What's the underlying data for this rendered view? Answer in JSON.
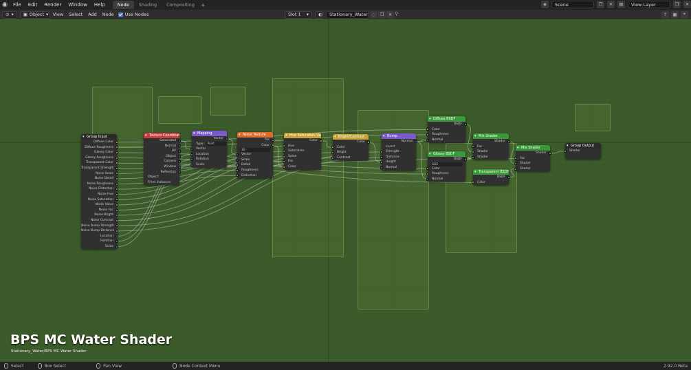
{
  "topbar": {
    "menus": [
      "File",
      "Edit",
      "Render",
      "Window",
      "Help"
    ],
    "workspaces": [
      "Node",
      "Shading",
      "Compositing"
    ],
    "active_workspace": "Node",
    "scene": "Scene",
    "view_layer": "View Layer"
  },
  "header": {
    "object_mode": "Object",
    "menus": [
      "View",
      "Select",
      "Add",
      "Node"
    ],
    "use_nodes": "Use Nodes",
    "slot": "Slot 1",
    "material": "Stationary_Water"
  },
  "overlay": {
    "title": "BPS MC Water Shader",
    "path": "Stationary_Water/BPS MC Water Shader"
  },
  "nodes": {
    "group_input": {
      "title": "Group Input",
      "outputs": [
        "Diffuse Color",
        "Diffuse Roughness",
        "Glossy Color",
        "Glossy Roughness",
        "Transparent Color",
        "Transparent Strength",
        "Noise Scale",
        "Noise Detail",
        "Noise Roughness",
        "Noise Distortion",
        "Noise Hue",
        "Noise Saturation",
        "Noise Value",
        "Noise Fac",
        "Noise Bright",
        "Noise Contrast",
        "Noise Bump Strength",
        "Noise Bump Distance",
        "Location",
        "Rotation",
        "Scale"
      ]
    },
    "texcoord": {
      "title": "Texture Coordinate",
      "outputs": [
        "Generated",
        "Normal",
        "UV",
        "Object",
        "Camera",
        "Window",
        "Reflection"
      ],
      "object_label": "Object:",
      "from_instancer": "From Instancer"
    },
    "mapping": {
      "title": "Mapping",
      "output": "Vector",
      "type_label": "Type:",
      "type_value": "Point",
      "inputs": [
        "Vector",
        "Location",
        "Rotation",
        "Scale"
      ]
    },
    "noise": {
      "title": "Noise Texture",
      "outputs": [
        "Fac",
        "Color"
      ],
      "dimension": "3D",
      "inputs": [
        "Vector",
        "Scale",
        "Detail",
        "Roughness",
        "Distortion"
      ]
    },
    "hsv": {
      "title": "Hue Saturation Value",
      "output": "Color",
      "inputs": [
        "Hue",
        "Saturation",
        "Value",
        "Fac",
        "Color"
      ]
    },
    "bright": {
      "title": "Bright/Contrast",
      "output": "Color",
      "inputs": [
        "Color",
        "Bright",
        "Contrast"
      ]
    },
    "bump": {
      "title": "Bump",
      "output": "Normal",
      "invert": "Invert",
      "inputs": [
        "Strength",
        "Distance",
        "Height",
        "Normal"
      ]
    },
    "diffuse": {
      "title": "Diffuse BSDF",
      "output": "BSDF",
      "inputs": [
        "Color",
        "Roughness",
        "Normal"
      ]
    },
    "glossy": {
      "title": "Glossy BSDF",
      "output": "BSDF",
      "distribution": "GGX",
      "inputs": [
        "Color",
        "Roughness",
        "Normal"
      ]
    },
    "transparent": {
      "title": "Transparent BSDF",
      "output": "BSDF",
      "inputs": [
        "Color"
      ]
    },
    "mix1": {
      "title": "Mix Shader",
      "output": "Shader",
      "inputs": [
        "Fac",
        "Shader",
        "Shader"
      ]
    },
    "mix2": {
      "title": "Mix Shader",
      "output": "Shader",
      "inputs": [
        "Fac",
        "Shader",
        "Shader"
      ]
    },
    "group_output": {
      "title": "Group Output",
      "inputs": [
        "Shader"
      ]
    }
  },
  "statusbar": {
    "select": "Select",
    "box_select": "Box Select",
    "pan_view": "Pan View",
    "context_menu": "Node Context Menu",
    "version": "2.92.0 Beta"
  },
  "colors": {
    "canvas": "#3b5a29",
    "input_header": "#2a2a2a",
    "texture_header": "#e06a2a",
    "vector_header": "#7c5ac7",
    "color_header": "#c7a33a",
    "shader_header": "#3a9a3a",
    "texcoord_header": "#c74040"
  }
}
